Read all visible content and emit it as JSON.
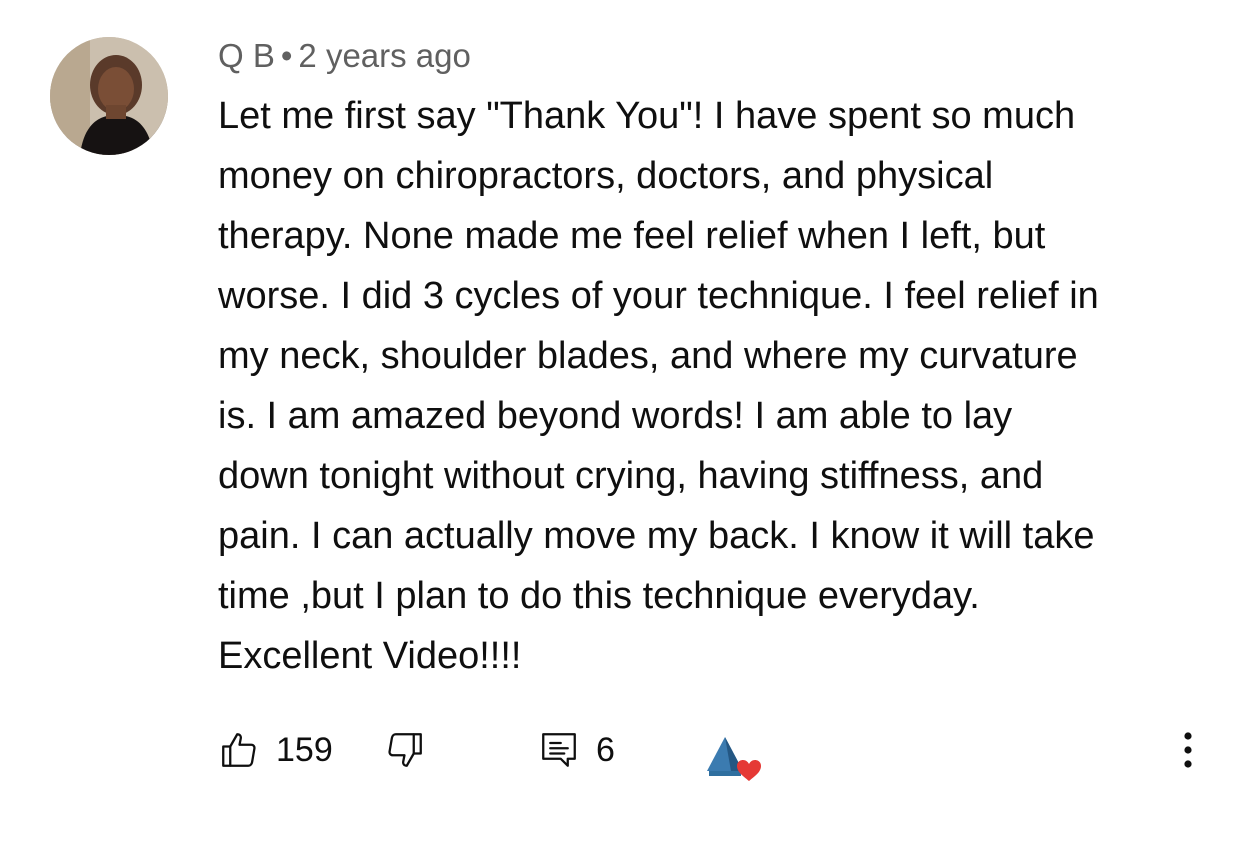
{
  "comment": {
    "author": "Q B",
    "separator": "•",
    "time": "2 years ago",
    "text": "Let me first say \"Thank You\"! I have spent so much\nmoney on chiropractors, doctors, and physical\ntherapy. None made me feel relief when I left, but\nworse. I did 3 cycles of your technique. I feel relief in\nmy neck, shoulder blades, and where my curvature\nis. I am amazed beyond words! I am able to lay\ndown tonight without  crying, having stiffness, and\npain. I can actually move my back. I know it will take\ntime ,but I plan to do this technique everyday.\nExcellent Video!!!!"
  },
  "actions": {
    "like_count": "159",
    "reply_count": "6"
  },
  "icons": {
    "like": "thumbs-up-icon",
    "dislike": "thumbs-down-icon",
    "reply": "comment-reply-icon",
    "creator_heart": "creator-heart-icon",
    "more": "more-vertical-icon"
  },
  "colors": {
    "meta_text": "#606060",
    "body_text": "#0f0f0f",
    "heart": "#e53935",
    "logo_blue": "#2f6f9f"
  }
}
